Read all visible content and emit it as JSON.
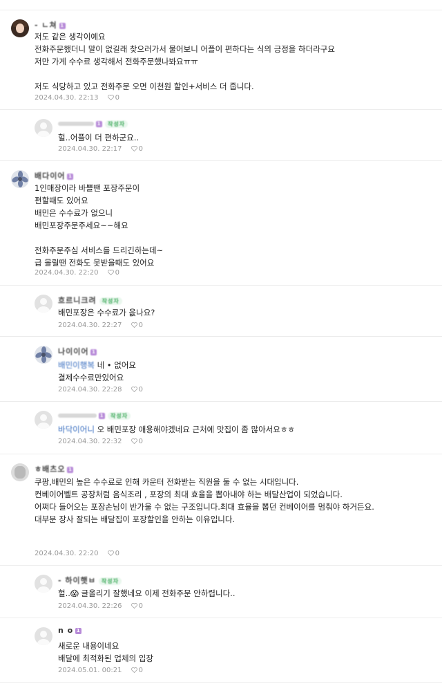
{
  "comments": [
    {
      "nick": "- ㄴ쳐",
      "body": [
        "저도 같은 생각이예요",
        "전화주문했더니 말이 없길래 찾으러가서 물어보니 어플이 편하다는 식의 긍정을 하더라구요",
        "저만 가게 수수료 생각해서 전화주문했나봐요ㅠㅠ",
        "",
        "저도 식당하고 있고 전화주문 오면 이천원 할인+서비스 더 줍니다."
      ],
      "date": "2024.04.30. 22:13",
      "likes": "0"
    },
    {
      "nick": "",
      "badge": "작성자",
      "body": [
        "헐..어플이 더 편하군요.."
      ],
      "date": "2024.04.30. 22:17",
      "likes": "0"
    },
    {
      "nick": "배다이어",
      "body": [
        "1인매장이라 바쁠땐 포장주문이",
        "편할때도 있어요",
        "배민은 수수료가 없으니",
        "배민포장주문주세요~~해요",
        "",
        "전화주문주심 서비스를 드리긴하는데~",
        "급 몰릴땐 전화도 못받을때도 있어요"
      ],
      "date": "2024.04.30. 22:20",
      "likes": "0"
    },
    {
      "nick": "흐르니크려",
      "badge": "작성자",
      "body": [
        "배민포장은 수수료가 읎나요?"
      ],
      "date": "2024.04.30. 22:27",
      "likes": "0"
    },
    {
      "nick": "나이이어",
      "mention": "배민이행복",
      "body": [
        "네 • 없어요",
        "결제수수료만있어요"
      ],
      "date": "2024.04.30. 22:28",
      "likes": "0"
    },
    {
      "nick": "",
      "badge": "작성자",
      "mention": "바닥이어니",
      "body": [
        "오 배민포장 애용해야겠네요 근처에 맛집이 좀 많아서요ㅎㅎ"
      ],
      "date": "2024.04.30. 22:32",
      "likes": "0"
    },
    {
      "nick": "ㅎ배츠오",
      "body": [
        "쿠팡,배민의 높은 수수료로 인해 카운터 전화받는 직원을 둘 수 없는 시대입니다.",
        "컨베이어벨트 공장처럼 음식조리 , 포장의 최대 효율을 뽑아내야 하는 배달산업이 되었습니다.",
        "어쩌다 들어오는 포장손님이 반가울 수 없는 구조입니다.최대 효율을 뽑던 컨베이어를 멈춰야 하거든요.",
        "대부분 장사 잘되는 배달집이 포장할인을 안하는 이유입니다."
      ],
      "date": "2024.04.30. 22:20",
      "likes": "0"
    },
    {
      "nick": "- 하이햇ㅂ",
      "badge": "작성자",
      "body": [
        "헐..😱 글올리기 잘했네요 이제 전화주문 안하렵니다.."
      ],
      "date": "2024.04.30. 22:26",
      "likes": "0"
    },
    {
      "nick": "n o",
      "body": [
        "새로운 내용이네요",
        "배달에 최적화된 업체의 입장"
      ],
      "date": "2024.05.01. 00:21",
      "likes": "0"
    }
  ]
}
